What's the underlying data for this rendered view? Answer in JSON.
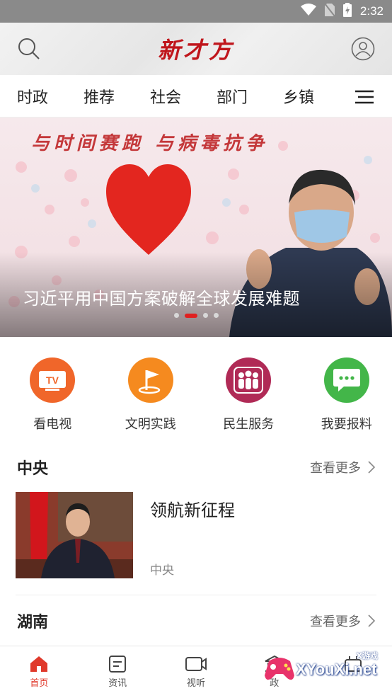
{
  "status_bar": {
    "time": "2:32"
  },
  "header": {
    "logo": "新才方"
  },
  "channel_tabs": [
    "时政",
    "推荐",
    "社会",
    "部门",
    "乡镇"
  ],
  "banner": {
    "slogan": "与时间赛跑 与病毒抗争",
    "caption": "习近平用中国方案破解全球发展难题",
    "slide_count": 4,
    "active_slide": 2
  },
  "quick_entries": [
    {
      "label": "看电视",
      "icon": "tv-icon",
      "color": "#f0662a",
      "badge": "TV"
    },
    {
      "label": "文明实践",
      "icon": "flag-icon",
      "color": "#f58a1f"
    },
    {
      "label": "民生服务",
      "icon": "people-icon",
      "color": "#b02a56"
    },
    {
      "label": "我要报料",
      "icon": "chat-icon",
      "color": "#43b649"
    }
  ],
  "sections": [
    {
      "title": "中央",
      "more_label": "查看更多",
      "items": [
        {
          "title": "领航新征程",
          "source": "中央"
        }
      ]
    },
    {
      "title": "湖南",
      "more_label": "查看更多"
    }
  ],
  "tab_bar": [
    {
      "label": "首页",
      "icon": "home-icon",
      "active": true
    },
    {
      "label": "资讯",
      "icon": "news-icon",
      "active": false
    },
    {
      "label": "视听",
      "icon": "video-icon",
      "active": false
    },
    {
      "label": "政",
      "icon": "government-icon",
      "active": false
    },
    {
      "label": "",
      "icon": "service-icon",
      "active": false
    }
  ],
  "watermark": {
    "text": "XYouXi.net",
    "small": "X游戏"
  },
  "colors": {
    "accent": "#e02020",
    "brand": "#c0161c"
  }
}
